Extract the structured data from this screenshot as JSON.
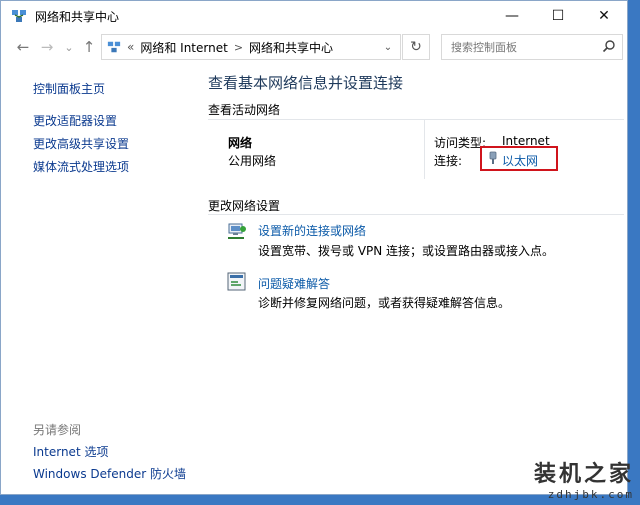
{
  "window": {
    "title": "网络和共享中心",
    "caption": {
      "minimize": "—",
      "maximize": "☐",
      "close": "✕"
    }
  },
  "nav": {
    "back": "←",
    "forward": "→",
    "dropdown": "⌄",
    "up": "↑",
    "address_prefix": "«",
    "breadcrumb": [
      "网络和 Internet",
      "网络和共享中心"
    ],
    "crumb_sep": ">",
    "refresh": "↻",
    "search_placeholder": "搜索控制面板"
  },
  "sidebar": {
    "links": [
      "控制面板主页",
      "更改适配器设置",
      "更改高级共享设置",
      "媒体流式处理选项"
    ],
    "see_also_label": "另请参阅",
    "see_also_links": [
      "Internet 选项",
      "Windows Defender 防火墙"
    ]
  },
  "main": {
    "heading": "查看基本网络信息并设置连接",
    "active_networks_label": "查看活动网络",
    "network": {
      "name": "网络",
      "profile": "公用网络",
      "access_type_label": "访问类型:",
      "access_type_value": "Internet",
      "connections_label": "连接:",
      "connection_link": "以太网"
    },
    "change_settings_label": "更改网络设置",
    "tasks": [
      {
        "title": "设置新的连接或网络",
        "desc": "设置宽带、拨号或 VPN 连接；或设置路由器或接入点。",
        "icon": "new-connection-icon"
      },
      {
        "title": "问题疑难解答",
        "desc": "诊断并修复网络问题，或者获得疑难解答信息。",
        "icon": "troubleshoot-icon"
      }
    ]
  },
  "watermark": {
    "line1": "装机之家",
    "line2": "zdhjbk.com"
  },
  "colors": {
    "link": "#0b5aa8",
    "sidebar_link": "#0b3a8f",
    "heading": "#1e395b",
    "highlight": "#d0141c",
    "desktop": "#3a78c2"
  }
}
